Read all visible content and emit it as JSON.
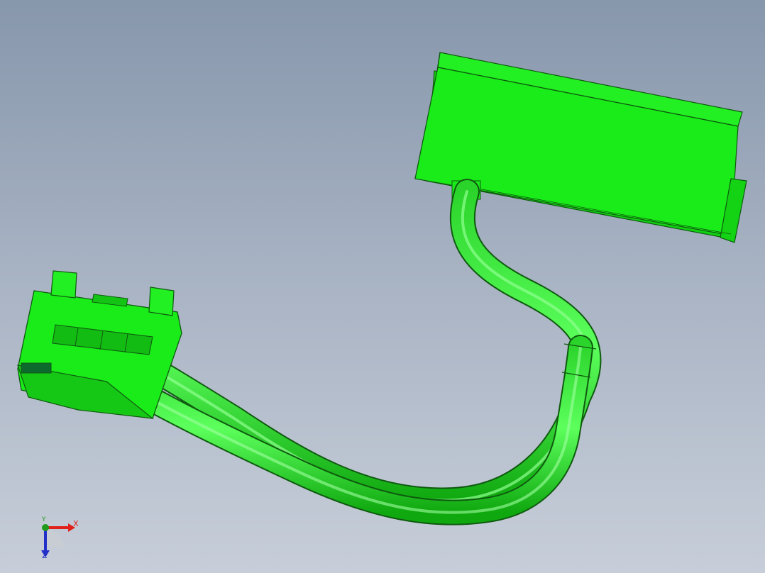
{
  "viewport": {
    "background_top": "#8797ac",
    "background_bottom": "#c7ced9"
  },
  "model": {
    "color": "#19ec19",
    "edge_color": "#0f5a0f",
    "parts": [
      "connector-housing",
      "cable-pair",
      "receptacle-block"
    ]
  },
  "triad": {
    "x_label": "X",
    "y_label": "Y",
    "z_label": "Z",
    "x_color": "#e0201a",
    "y_color": "#1f9a1f",
    "z_color": "#2230c8"
  }
}
